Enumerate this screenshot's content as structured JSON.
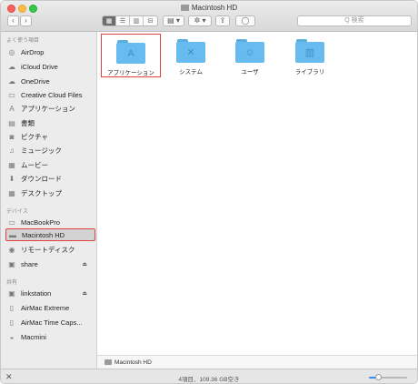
{
  "window": {
    "title": "Macintosh HD"
  },
  "toolbar": {
    "back_label": "‹",
    "forward_label": "›",
    "view_buttons": [
      "▦",
      "☰",
      "▥",
      "⊟"
    ],
    "group_label": "▤ ▾",
    "action_label": "✲ ▾",
    "share_label": "⇪",
    "tag_label": "◯",
    "search_placeholder": "Q 検索"
  },
  "sidebar": {
    "favorites_header": "よく使う項目",
    "favorites": [
      {
        "label": "AirDrop",
        "icon": "airdrop-icon",
        "glyph": "◎"
      },
      {
        "label": "iCloud Drive",
        "icon": "cloud-icon",
        "glyph": "☁"
      },
      {
        "label": "OneDrive",
        "icon": "cloud-icon",
        "glyph": "☁"
      },
      {
        "label": "Creative Cloud Files",
        "icon": "folder-icon",
        "glyph": "▭"
      },
      {
        "label": "アプリケーション",
        "icon": "applications-icon",
        "glyph": "A"
      },
      {
        "label": "書類",
        "icon": "documents-icon",
        "glyph": "▤"
      },
      {
        "label": "ピクチャ",
        "icon": "camera-icon",
        "glyph": "◙"
      },
      {
        "label": "ミュージック",
        "icon": "music-icon",
        "glyph": "♫"
      },
      {
        "label": "ムービー",
        "icon": "film-icon",
        "glyph": "▦"
      },
      {
        "label": "ダウンロード",
        "icon": "download-icon",
        "glyph": "⬇"
      },
      {
        "label": "デスクトップ",
        "icon": "desktop-icon",
        "glyph": "▦"
      }
    ],
    "devices_header": "デバイス",
    "devices": [
      {
        "label": "MacBookPro",
        "icon": "laptop-icon",
        "glyph": "▭"
      },
      {
        "label": "Macintosh HD",
        "icon": "disk-icon",
        "glyph": "▬"
      },
      {
        "label": "リモートディスク",
        "icon": "remote-disc-icon",
        "glyph": "◉"
      },
      {
        "label": "share",
        "icon": "network-disk-icon",
        "glyph": "▣",
        "eject": "⏏"
      }
    ],
    "shared_header": "共有",
    "shared": [
      {
        "label": "linkstation",
        "icon": "network-disk-icon",
        "glyph": "▣",
        "eject": "⏏"
      },
      {
        "label": "AirMac Extreme",
        "icon": "router-icon",
        "glyph": "▯"
      },
      {
        "label": "AirMac Time Caps...",
        "icon": "router-icon",
        "glyph": "▯"
      },
      {
        "label": "Macmini",
        "icon": "computer-icon",
        "glyph": "◒"
      }
    ]
  },
  "content": {
    "folders": [
      {
        "label": "アプリケーション",
        "glyph": "A",
        "selected": true
      },
      {
        "label": "システム",
        "glyph": "✕",
        "selected": false
      },
      {
        "label": "ユーザ",
        "glyph": "☺",
        "selected": false
      },
      {
        "label": "ライブラリ",
        "glyph": "▥",
        "selected": false
      }
    ]
  },
  "pathbar": {
    "label": "Macintosh HD"
  },
  "statusbar": {
    "text": "4項目、109.36 GB空き",
    "close_label": "✕",
    "icon_size_level": 0.2
  },
  "colors": {
    "selection_outline": "#e04040",
    "folder_blue": "#67bbee",
    "slider_blue": "#3b8ef0"
  }
}
